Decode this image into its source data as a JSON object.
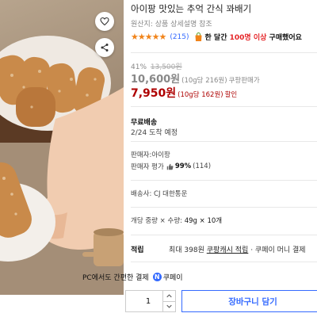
{
  "product": {
    "title": "아이팡 맛있는 추억 간식 꽈배기",
    "origin": "원산지: 상품 상세설명 참조",
    "rating_stars": "★★★★★",
    "review_count": "(215)",
    "buyers_prefix": "한 달간",
    "buyers_count": "100명 이상",
    "buyers_suffix": "구매했어요"
  },
  "pricing": {
    "discount_rate": "41%",
    "original_price": "13,500원",
    "price": "10,600원",
    "price_unit": "(10g당 216원)",
    "price_tag": "쿠팡판매가",
    "sale_price": "7,950원",
    "sale_unit": "(10g당 162원)",
    "sale_tag": "할인"
  },
  "shipping": {
    "title": "무료배송",
    "date": "2/24 도착 예정"
  },
  "seller": {
    "name_line": "판매자:아이팡",
    "eval_label": "판매자 평가",
    "eval_pct": "99%",
    "eval_count": "(114)"
  },
  "delivery": {
    "line": "배송사: CJ 대한통운"
  },
  "option": {
    "label": "개당 중량 × 수량:",
    "value": "49g × 10개"
  },
  "reward": {
    "label": "적립",
    "prefix": "최대 398원",
    "cash": "쿠팡캐시 적립",
    "suffix": "· 쿠페이 머니 결제"
  },
  "checkout": {
    "pc_pay": "PC에서도 간편한 결제",
    "pay_badge": "N",
    "pay_name": "쿠페이",
    "quantity": "1",
    "cart_label": "장바구니 담기"
  },
  "colors": {
    "accent": "#346aff",
    "sale": "#ae0000",
    "star": "#f1841a",
    "buyers_count": "#e52528"
  },
  "icons": [
    "heart-icon",
    "share-icon",
    "shopping-bag-icon",
    "chevron-up-icon",
    "chevron-down-icon"
  ]
}
